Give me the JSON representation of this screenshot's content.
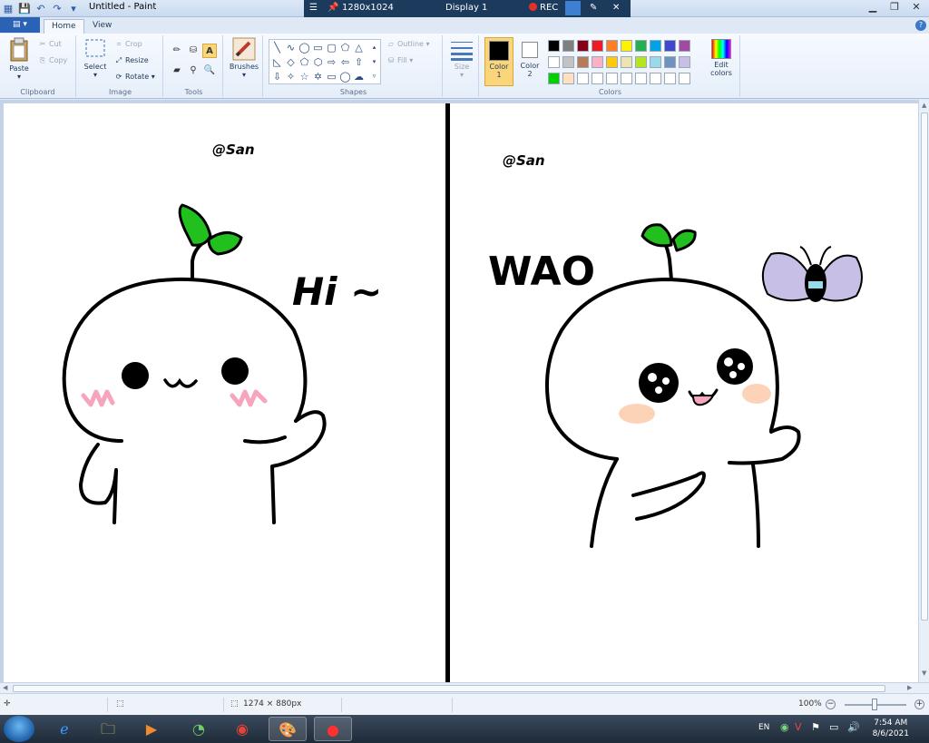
{
  "window": {
    "title": "Untitled - Paint"
  },
  "remote": {
    "resolution": "1280x1024",
    "display": "Display 1",
    "rec": "REC"
  },
  "tabs": {
    "home": "Home",
    "view": "View"
  },
  "ribbon": {
    "clipboard": {
      "label": "Clipboard",
      "paste": "Paste",
      "cut": "Cut",
      "copy": "Copy"
    },
    "image": {
      "label": "Image",
      "select": "Select",
      "crop": "Crop",
      "resize": "Resize",
      "rotate": "Rotate"
    },
    "tools": {
      "label": "Tools"
    },
    "brushes": {
      "label": "Brushes"
    },
    "shapes": {
      "label": "Shapes",
      "outline": "Outline",
      "fill": "Fill"
    },
    "size": {
      "label": "Size"
    },
    "colors": {
      "label": "Colors",
      "color1": "Color\n1",
      "color2": "Color\n2",
      "edit": "Edit colors",
      "palette_row1": [
        "#000000",
        "#7f7f7f",
        "#880015",
        "#ed1c24",
        "#ff7f27",
        "#fff200",
        "#22b14c",
        "#00a2e8",
        "#3f48cc",
        "#a349a4"
      ],
      "palette_row2": [
        "#ffffff",
        "#c3c3c3",
        "#b97a57",
        "#ffaec9",
        "#ffc90e",
        "#efe4b0",
        "#b5e61d",
        "#99d9ea",
        "#7092be",
        "#c8bfe7"
      ],
      "palette_row3": [
        "#00d000",
        "#ffe0c0",
        "#ffffff",
        "#ffffff",
        "#ffffff",
        "#ffffff",
        "#ffffff",
        "#ffffff",
        "#ffffff",
        "#ffffff"
      ]
    }
  },
  "canvas_text": {
    "left_sig": "@San",
    "left_greeting": "Hi ~",
    "right_sig": "@San",
    "right_exclaim": "WAO"
  },
  "status": {
    "size": "1274 × 880px",
    "zoom": "100%"
  },
  "taskbar": {
    "lang": "EN",
    "time": "7:54 AM",
    "date": "8/6/2021"
  }
}
